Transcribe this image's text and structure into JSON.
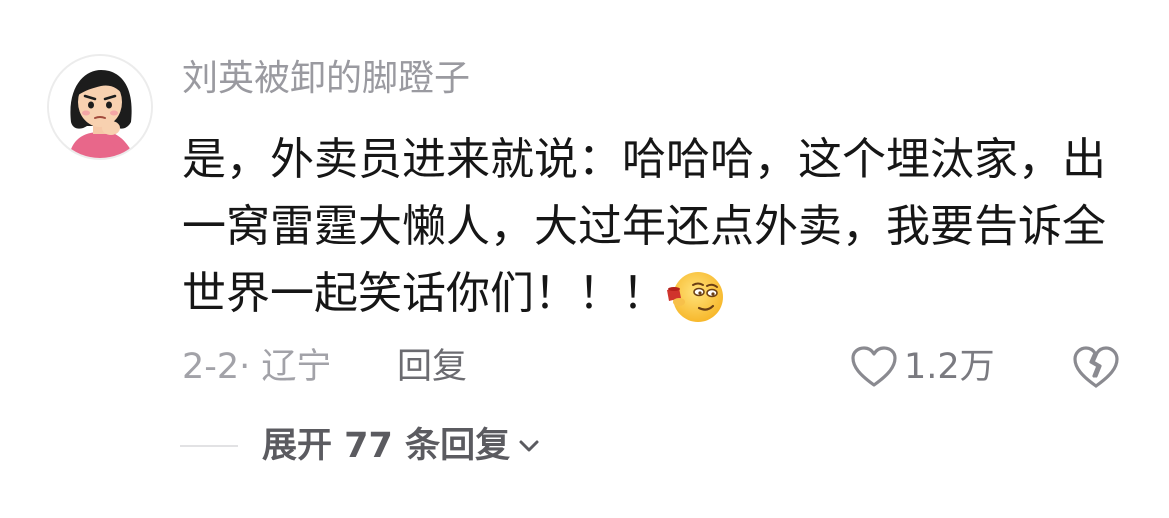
{
  "comment": {
    "username": "刘英被卸的脚蹬子",
    "text_lines": [
      "是，外卖员进来就说：哈哈哈，这个埋汰家，出",
      "一窝雷霆大懒人，大过年还点外卖，我要告诉全",
      "世界一起笑话你们！！！"
    ],
    "emoji": "smirk-emoji",
    "date_location": "2-2· 辽宁",
    "reply_label": "回复",
    "like_count": "1.2万",
    "expand_replies_label": "展开 77 条回复"
  },
  "icons": {
    "like": "heart-outline-icon",
    "dislike": "broken-heart-icon",
    "expand": "chevron-down-icon"
  },
  "colors": {
    "username": "#9a9aa0",
    "text": "#161616",
    "meta": "#a2a2a8",
    "icon": "#8a8a90"
  }
}
